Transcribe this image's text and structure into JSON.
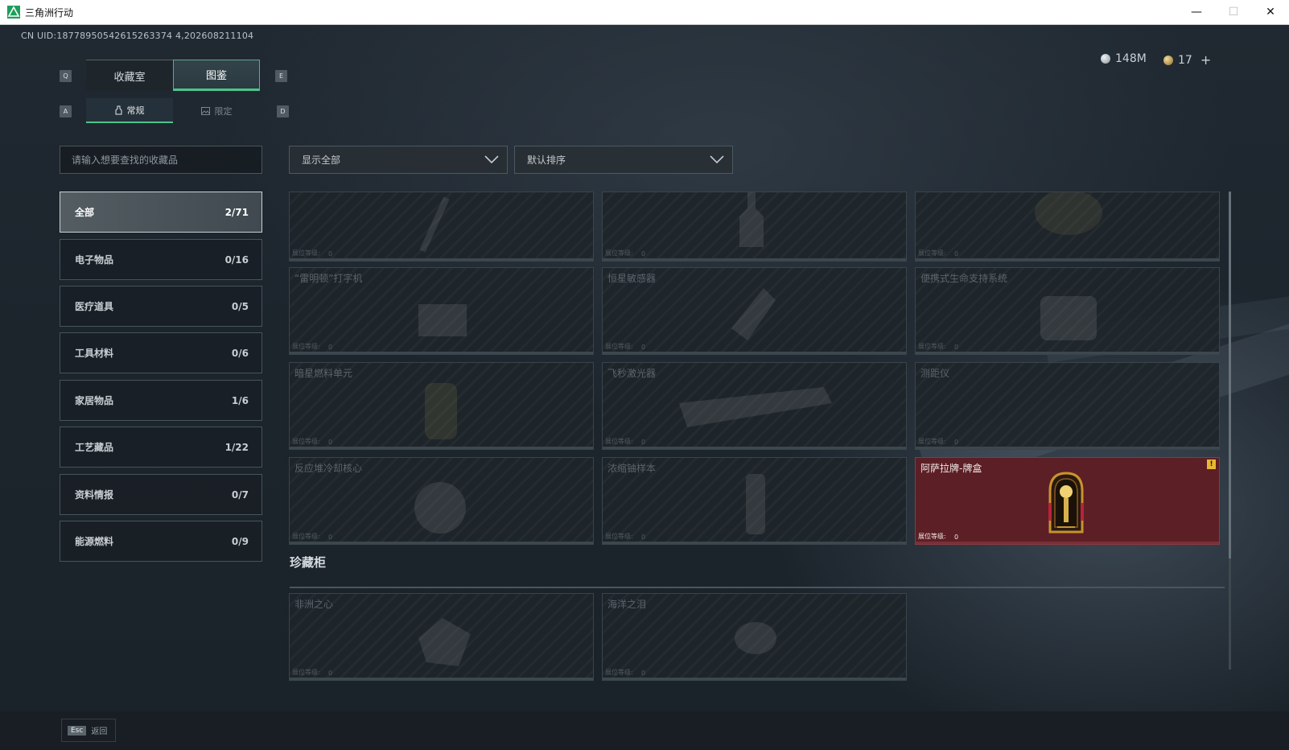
{
  "window": {
    "title": "三角洲行动",
    "buttons": {
      "minimize": "—",
      "maximize": "☐",
      "close": "✕"
    }
  },
  "uid": "CN UID:18778950542615263374 4,202608211104",
  "currency": [
    {
      "icon": "silver-coin-icon",
      "value": "148M"
    },
    {
      "icon": "gold-coin-icon",
      "value": "17",
      "add": "+"
    }
  ],
  "keys": {
    "prev_tab": "Q",
    "next_tab": "E",
    "prev_sub": "A",
    "next_sub": "D"
  },
  "main_tabs": [
    {
      "label": "收藏室",
      "active": false
    },
    {
      "label": "图鉴",
      "active": true
    }
  ],
  "sub_tabs": [
    {
      "label": "常规",
      "active": true
    },
    {
      "label": "限定",
      "active": false
    }
  ],
  "search": {
    "placeholder": "请输入想要查找的收藏品"
  },
  "filters": {
    "show": "显示全部",
    "sort": "默认排序"
  },
  "categories": [
    {
      "label": "全部",
      "count": "2/71",
      "active": true
    },
    {
      "label": "电子物品",
      "count": "0/16"
    },
    {
      "label": "医疗道具",
      "count": "0/5"
    },
    {
      "label": "工具材料",
      "count": "0/6"
    },
    {
      "label": "家居物品",
      "count": "1/6"
    },
    {
      "label": "工艺藏品",
      "count": "1/22"
    },
    {
      "label": "资料情报",
      "count": "0/7"
    },
    {
      "label": "能源燃料",
      "count": "0/9"
    }
  ],
  "level_label": "展位等级:",
  "items": [
    {
      "name": "",
      "level": "0"
    },
    {
      "name": "",
      "level": "0"
    },
    {
      "name": "",
      "level": "0"
    },
    {
      "name": "“雷明顿”打字机",
      "level": "0"
    },
    {
      "name": "恒星敏感器",
      "level": "0"
    },
    {
      "name": "便携式生命支持系统",
      "level": "0"
    },
    {
      "name": "暗星燃料单元",
      "level": "0"
    },
    {
      "name": "飞秒激光器",
      "level": "0"
    },
    {
      "name": "测距仪",
      "level": "0"
    },
    {
      "name": "反应堆冷却核心",
      "level": "0"
    },
    {
      "name": "浓缩铀样本",
      "level": "0"
    },
    {
      "name": "阿萨拉牌-牌盒",
      "level": "0",
      "owned": true,
      "badge": "!"
    }
  ],
  "section": {
    "title": "珍藏柜"
  },
  "treasure_items": [
    {
      "name": "非洲之心",
      "level": "0"
    },
    {
      "name": "海洋之泪",
      "level": "0"
    }
  ],
  "bottom": {
    "esc_key": "Esc",
    "back_label": "返回"
  },
  "colors": {
    "accent": "#4ec48c",
    "owned_card": "#5c1f25",
    "badge": "#e8b830"
  }
}
